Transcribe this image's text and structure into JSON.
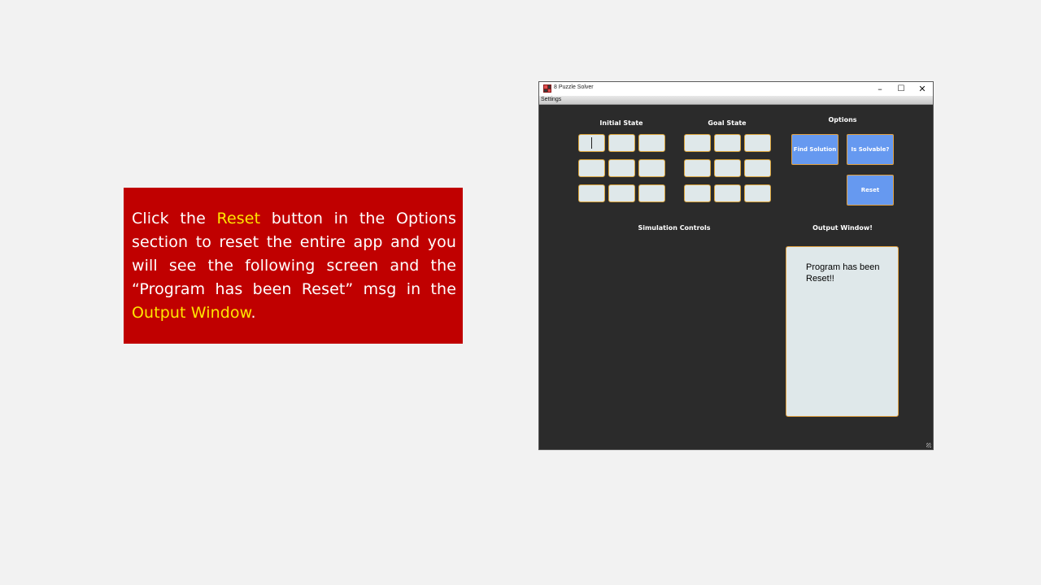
{
  "instruction": {
    "part1": "Click the ",
    "highlight1": "Reset",
    "part2": " button in the Options section to reset the entire app and you will see the following screen and the “Program has been Reset” msg in the ",
    "highlight2": "Output Window",
    "part3": "."
  },
  "window": {
    "title": "8 Puzzle Solver",
    "minimize_glyph": "–",
    "maximize_glyph": "☐",
    "close_glyph": "✕"
  },
  "menubar": {
    "settings_label": "Settings"
  },
  "sections": {
    "initial_state": "Initial State",
    "goal_state": "Goal State",
    "options": "Options",
    "simulation_controls": "Simulation Controls",
    "output_window": "Output Window!"
  },
  "buttons": {
    "find_solution": "Find Solution",
    "is_solvable": "Is Solvable?",
    "reset": "Reset"
  },
  "initial_cells": [
    "",
    "",
    "",
    "",
    "",
    "",
    "",
    "",
    ""
  ],
  "goal_cells": [
    "",
    "",
    "",
    "",
    "",
    "",
    "",
    "",
    ""
  ],
  "output": {
    "message": "Program has been Reset!!"
  },
  "colors": {
    "callout_bg": "#c00000",
    "highlight": "#ffe600",
    "window_bg": "#2b2b2b",
    "button_bg": "#6699f0",
    "border_accent": "#e0a040"
  }
}
